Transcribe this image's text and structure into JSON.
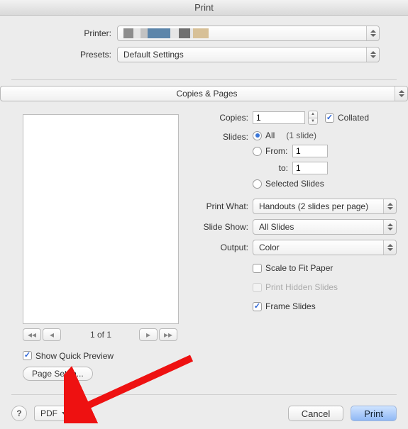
{
  "window": {
    "title": "Print"
  },
  "top": {
    "printer_label": "Printer:",
    "presets_label": "Presets:",
    "presets_value": "Default Settings"
  },
  "section_select": "Copies & Pages",
  "preview": {
    "page_counter": "1 of 1",
    "show_quick_preview": "Show Quick Preview",
    "page_setup": "Page Setup..."
  },
  "right": {
    "copies_label": "Copies:",
    "copies_value": "1",
    "collated": "Collated",
    "slides_label": "Slides:",
    "all_label": "All",
    "all_count": "(1 slide)",
    "from_label": "From:",
    "from_value": "1",
    "to_label": "to:",
    "to_value": "1",
    "selected_slides": "Selected Slides",
    "print_what_label": "Print What:",
    "print_what_value": "Handouts (2 slides per page)",
    "slide_show_label": "Slide Show:",
    "slide_show_value": "All Slides",
    "output_label": "Output:",
    "output_value": "Color",
    "scale_to_fit": "Scale to Fit Paper",
    "print_hidden": "Print Hidden Slides",
    "frame_slides": "Frame Slides"
  },
  "footer": {
    "pdf": "PDF",
    "cancel": "Cancel",
    "print": "Print"
  }
}
